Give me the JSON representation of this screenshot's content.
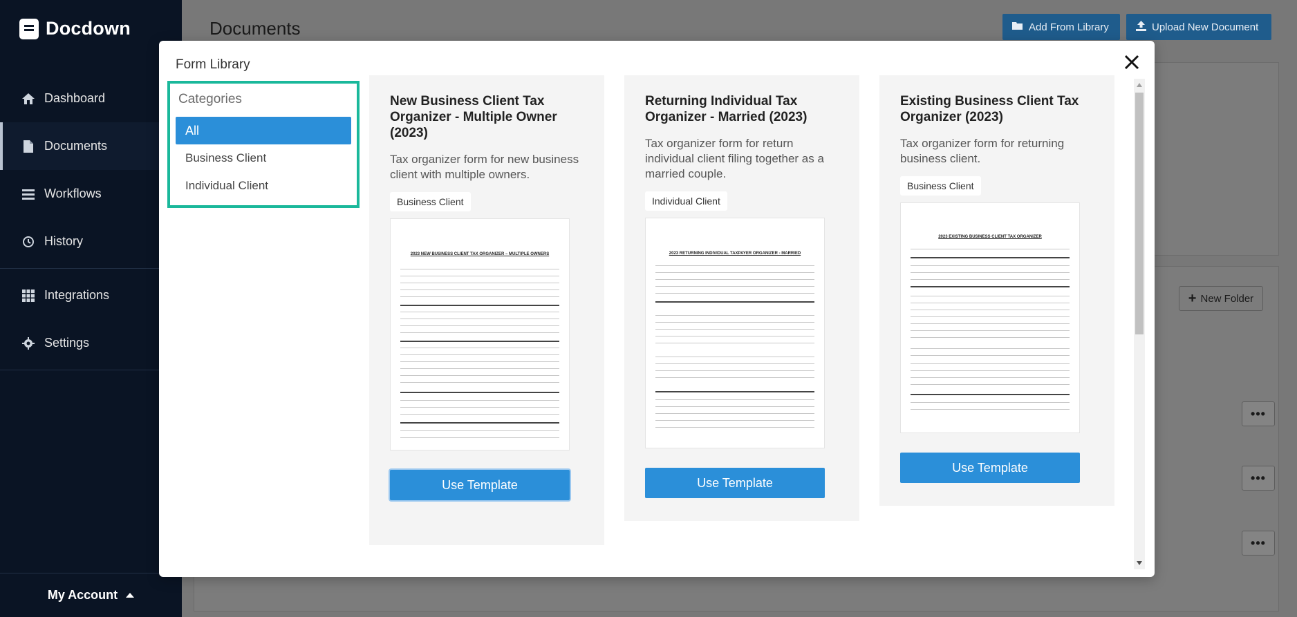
{
  "app": {
    "name": "Docdown"
  },
  "sidebar": {
    "items": [
      {
        "label": "Dashboard",
        "icon": "home-icon"
      },
      {
        "label": "Documents",
        "icon": "file-icon"
      },
      {
        "label": "Workflows",
        "icon": "list-icon"
      },
      {
        "label": "History",
        "icon": "history-icon"
      },
      {
        "label": "Integrations",
        "icon": "grid-icon"
      },
      {
        "label": "Settings",
        "icon": "gear-icon"
      }
    ],
    "account_label": "My Account"
  },
  "main": {
    "title": "Documents",
    "add_from_library": "Add From Library",
    "upload_new": "Upload New Document",
    "new_folder": "New Folder"
  },
  "modal": {
    "title": "Form Library",
    "categories_title": "Categories",
    "categories": [
      "All",
      "Business Client",
      "Individual Client"
    ],
    "selected_category": "All",
    "templates": [
      {
        "title": "New Business Client Tax Organizer - Multiple Owner (2023)",
        "description": "Tax organizer form for new business client with multiple owners.",
        "badge": "Business Client",
        "preview_heading": "2023 NEW BUSINESS CLIENT TAX ORGANIZER – MULTIPLE OWNERS",
        "button": "Use Template"
      },
      {
        "title": "Returning Individual Tax Organizer - Married (2023)",
        "description": "Tax organizer form for return individual client filing together as a married couple.",
        "badge": "Individual Client",
        "preview_heading": "2023 RETURNING INDIVIDUAL TAXPAYER ORGANIZER - MARRIED",
        "button": "Use Template"
      },
      {
        "title": "Existing Business Client Tax Organizer (2023)",
        "description": "Tax organizer form for returning business client.",
        "badge": "Business Client",
        "preview_heading": "2023 EXISTING BUSINESS CLIENT TAX ORGANIZER",
        "button": "Use Template"
      }
    ]
  },
  "colors": {
    "accent": "#2b8fd9",
    "sidebar_bg": "#0a1424",
    "highlight": "#1ab89b"
  }
}
